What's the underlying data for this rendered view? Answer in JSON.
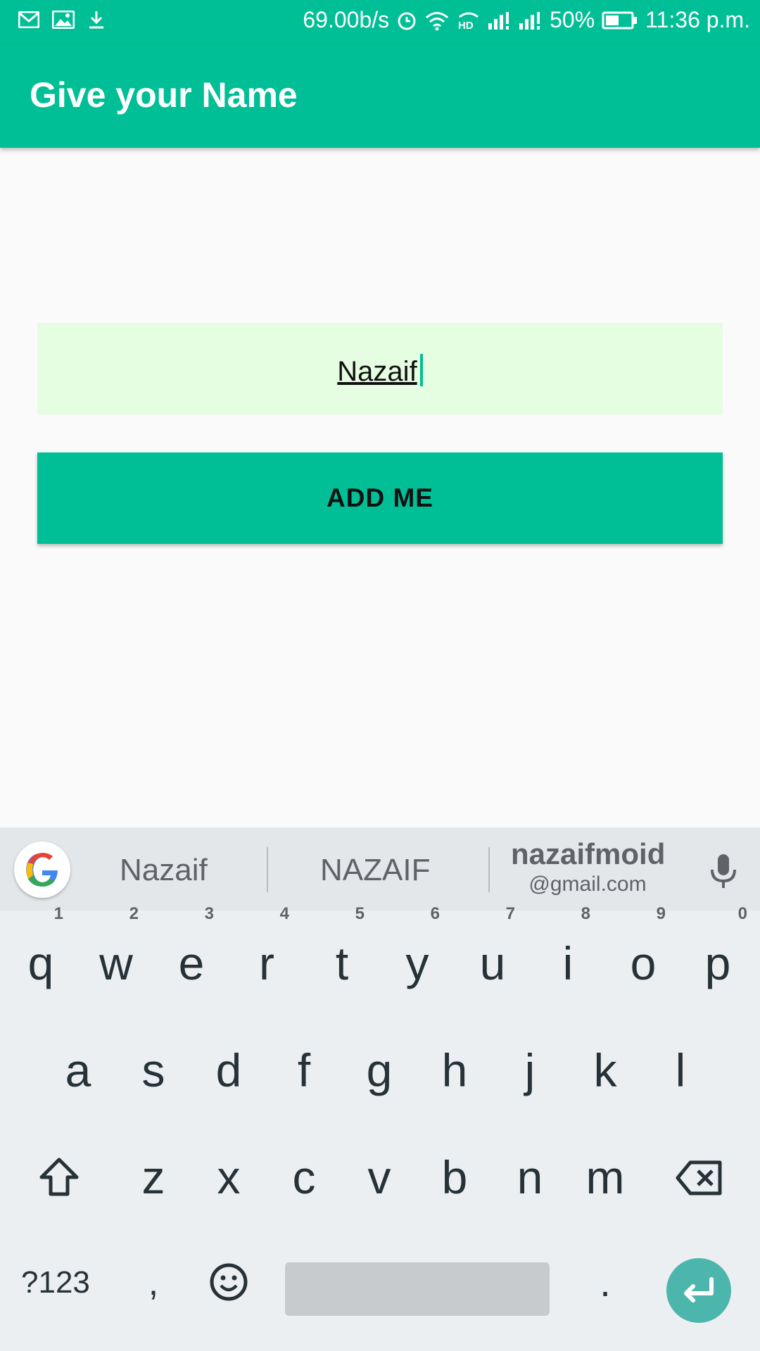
{
  "status_bar": {
    "net_speed": "69.00b/s",
    "battery": "50%",
    "time": "11:36 p.m."
  },
  "app_bar": {
    "title": "Give your Name"
  },
  "name_input": {
    "value": "Nazaif"
  },
  "add_button": {
    "label": "ADD ME"
  },
  "keyboard": {
    "suggestions": [
      "Nazaif",
      "NAZAIF"
    ],
    "email_suggestion": {
      "user": "nazaifmoid",
      "domain": "@gmail.com"
    },
    "row1": [
      "q",
      "w",
      "e",
      "r",
      "t",
      "y",
      "u",
      "i",
      "o",
      "p"
    ],
    "row1_hints": [
      "1",
      "2",
      "3",
      "4",
      "5",
      "6",
      "7",
      "8",
      "9",
      "0"
    ],
    "row2": [
      "a",
      "s",
      "d",
      "f",
      "g",
      "h",
      "j",
      "k",
      "l"
    ],
    "row3": [
      "z",
      "x",
      "c",
      "v",
      "b",
      "n",
      "m"
    ],
    "symbols_key": "?123",
    "comma_key": ",",
    "period_key": "."
  }
}
